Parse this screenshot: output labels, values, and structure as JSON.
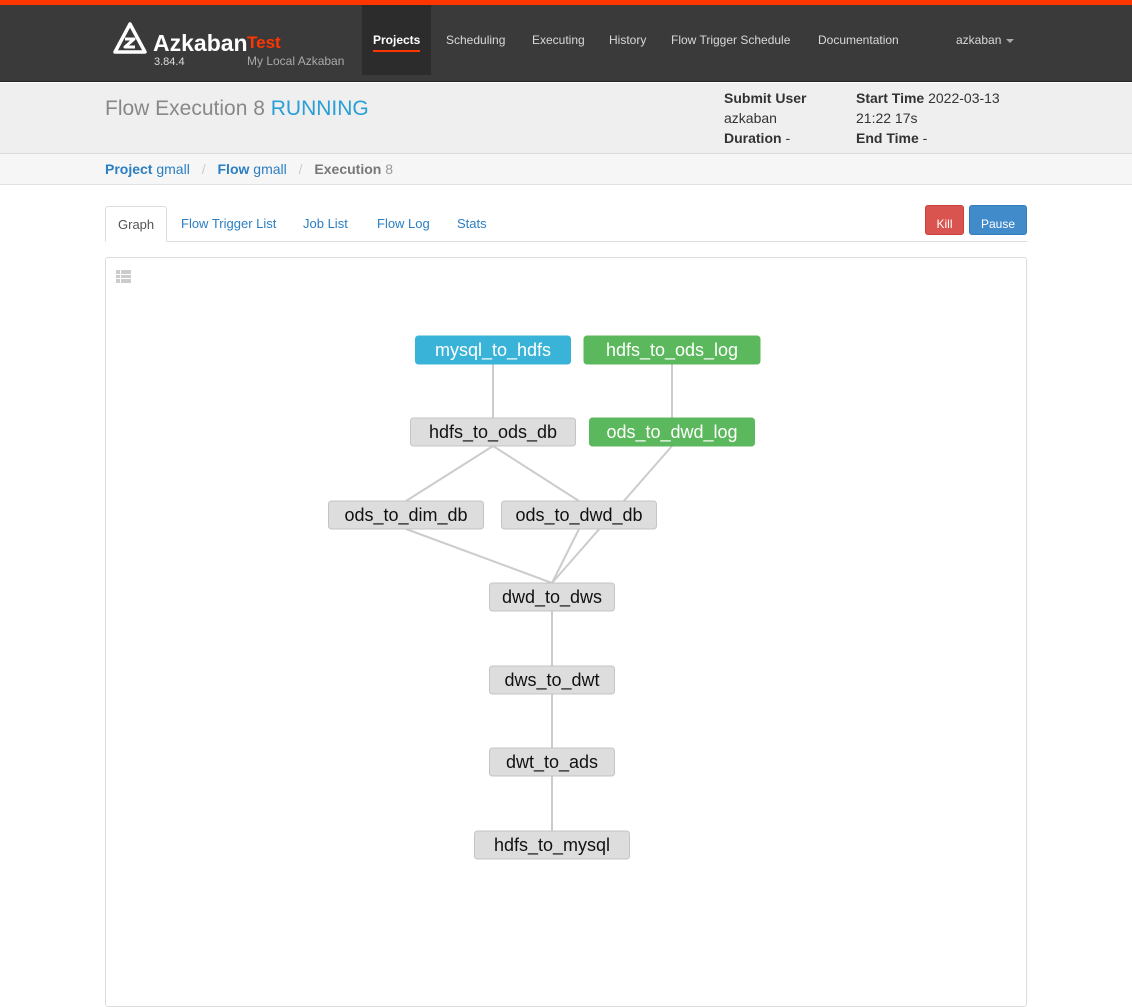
{
  "brand": {
    "name": "Azkaban",
    "env": "Test",
    "version": "3.84.4",
    "description": "My Local Azkaban",
    "accent_color": "#ff3601"
  },
  "nav": {
    "items": [
      {
        "label": "Projects",
        "active": true
      },
      {
        "label": "Scheduling"
      },
      {
        "label": "Executing"
      },
      {
        "label": "History"
      },
      {
        "label": "Flow Trigger Schedule"
      },
      {
        "label": "Documentation"
      }
    ],
    "user": "azkaban"
  },
  "header": {
    "title_prefix": "Flow Execution 8",
    "status": "RUNNING",
    "submit_user_label": "Submit User",
    "submit_user": "azkaban",
    "duration_label": "Duration",
    "duration": "-",
    "start_time_label": "Start Time",
    "start_time_date": "2022-03-13",
    "start_time_clock": "21:22 17s",
    "end_time_label": "End Time",
    "end_time": "-"
  },
  "breadcrumb": {
    "project_label": "Project",
    "project": "gmall",
    "flow_label": "Flow",
    "flow": "gmall",
    "execution_label": "Execution",
    "execution": "8"
  },
  "tabs": [
    "Graph",
    "Flow Trigger List",
    "Job List",
    "Flow Log",
    "Stats"
  ],
  "actions": {
    "kill": "Kill",
    "pause": "Pause"
  },
  "graph": {
    "status_colors": {
      "running": "#39b3d7",
      "succeeded": "#5cb85c",
      "ready": "#dddddd"
    },
    "nodes": [
      {
        "id": "mysql_to_hdfs",
        "status": "running"
      },
      {
        "id": "hdfs_to_ods_log",
        "status": "succeeded"
      },
      {
        "id": "hdfs_to_ods_db",
        "status": "ready"
      },
      {
        "id": "ods_to_dwd_log",
        "status": "succeeded"
      },
      {
        "id": "ods_to_dim_db",
        "status": "ready"
      },
      {
        "id": "ods_to_dwd_db",
        "status": "ready"
      },
      {
        "id": "dwd_to_dws",
        "status": "ready"
      },
      {
        "id": "dws_to_dwt",
        "status": "ready"
      },
      {
        "id": "dwt_to_ads",
        "status": "ready"
      },
      {
        "id": "hdfs_to_mysql",
        "status": "ready"
      }
    ],
    "edges": [
      [
        "mysql_to_hdfs",
        "hdfs_to_ods_db"
      ],
      [
        "hdfs_to_ods_log",
        "ods_to_dwd_log"
      ],
      [
        "hdfs_to_ods_db",
        "ods_to_dim_db"
      ],
      [
        "hdfs_to_ods_db",
        "ods_to_dwd_db"
      ],
      [
        "ods_to_dim_db",
        "dwd_to_dws"
      ],
      [
        "ods_to_dwd_db",
        "dwd_to_dws"
      ],
      [
        "ods_to_dwd_log",
        "dwd_to_dws"
      ],
      [
        "dwd_to_dws",
        "dws_to_dwt"
      ],
      [
        "dws_to_dwt",
        "dwt_to_ads"
      ],
      [
        "dwt_to_ads",
        "hdfs_to_mysql"
      ]
    ]
  }
}
